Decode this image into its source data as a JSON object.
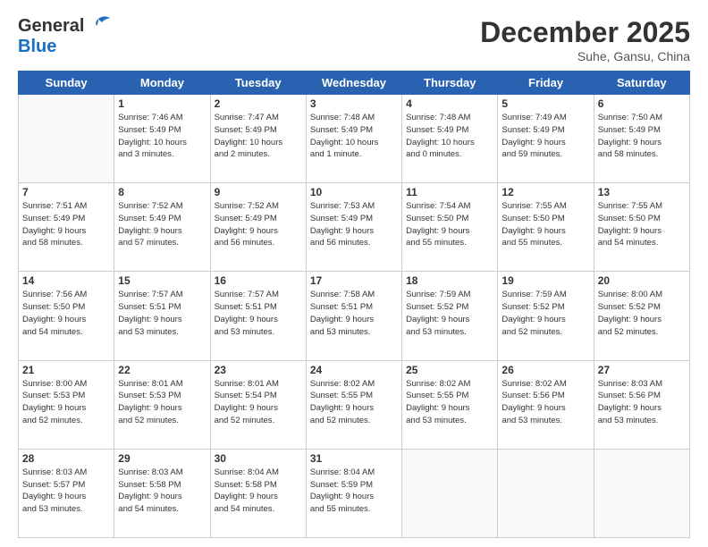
{
  "header": {
    "logo_general": "General",
    "logo_blue": "Blue",
    "month_title": "December 2025",
    "subtitle": "Suhe, Gansu, China"
  },
  "days_of_week": [
    "Sunday",
    "Monday",
    "Tuesday",
    "Wednesday",
    "Thursday",
    "Friday",
    "Saturday"
  ],
  "weeks": [
    [
      {
        "day": "",
        "info": ""
      },
      {
        "day": "1",
        "info": "Sunrise: 7:46 AM\nSunset: 5:49 PM\nDaylight: 10 hours\nand 3 minutes."
      },
      {
        "day": "2",
        "info": "Sunrise: 7:47 AM\nSunset: 5:49 PM\nDaylight: 10 hours\nand 2 minutes."
      },
      {
        "day": "3",
        "info": "Sunrise: 7:48 AM\nSunset: 5:49 PM\nDaylight: 10 hours\nand 1 minute."
      },
      {
        "day": "4",
        "info": "Sunrise: 7:48 AM\nSunset: 5:49 PM\nDaylight: 10 hours\nand 0 minutes."
      },
      {
        "day": "5",
        "info": "Sunrise: 7:49 AM\nSunset: 5:49 PM\nDaylight: 9 hours\nand 59 minutes."
      },
      {
        "day": "6",
        "info": "Sunrise: 7:50 AM\nSunset: 5:49 PM\nDaylight: 9 hours\nand 58 minutes."
      }
    ],
    [
      {
        "day": "7",
        "info": "Sunrise: 7:51 AM\nSunset: 5:49 PM\nDaylight: 9 hours\nand 58 minutes."
      },
      {
        "day": "8",
        "info": "Sunrise: 7:52 AM\nSunset: 5:49 PM\nDaylight: 9 hours\nand 57 minutes."
      },
      {
        "day": "9",
        "info": "Sunrise: 7:52 AM\nSunset: 5:49 PM\nDaylight: 9 hours\nand 56 minutes."
      },
      {
        "day": "10",
        "info": "Sunrise: 7:53 AM\nSunset: 5:49 PM\nDaylight: 9 hours\nand 56 minutes."
      },
      {
        "day": "11",
        "info": "Sunrise: 7:54 AM\nSunset: 5:50 PM\nDaylight: 9 hours\nand 55 minutes."
      },
      {
        "day": "12",
        "info": "Sunrise: 7:55 AM\nSunset: 5:50 PM\nDaylight: 9 hours\nand 55 minutes."
      },
      {
        "day": "13",
        "info": "Sunrise: 7:55 AM\nSunset: 5:50 PM\nDaylight: 9 hours\nand 54 minutes."
      }
    ],
    [
      {
        "day": "14",
        "info": "Sunrise: 7:56 AM\nSunset: 5:50 PM\nDaylight: 9 hours\nand 54 minutes."
      },
      {
        "day": "15",
        "info": "Sunrise: 7:57 AM\nSunset: 5:51 PM\nDaylight: 9 hours\nand 53 minutes."
      },
      {
        "day": "16",
        "info": "Sunrise: 7:57 AM\nSunset: 5:51 PM\nDaylight: 9 hours\nand 53 minutes."
      },
      {
        "day": "17",
        "info": "Sunrise: 7:58 AM\nSunset: 5:51 PM\nDaylight: 9 hours\nand 53 minutes."
      },
      {
        "day": "18",
        "info": "Sunrise: 7:59 AM\nSunset: 5:52 PM\nDaylight: 9 hours\nand 53 minutes."
      },
      {
        "day": "19",
        "info": "Sunrise: 7:59 AM\nSunset: 5:52 PM\nDaylight: 9 hours\nand 52 minutes."
      },
      {
        "day": "20",
        "info": "Sunrise: 8:00 AM\nSunset: 5:52 PM\nDaylight: 9 hours\nand 52 minutes."
      }
    ],
    [
      {
        "day": "21",
        "info": "Sunrise: 8:00 AM\nSunset: 5:53 PM\nDaylight: 9 hours\nand 52 minutes."
      },
      {
        "day": "22",
        "info": "Sunrise: 8:01 AM\nSunset: 5:53 PM\nDaylight: 9 hours\nand 52 minutes."
      },
      {
        "day": "23",
        "info": "Sunrise: 8:01 AM\nSunset: 5:54 PM\nDaylight: 9 hours\nand 52 minutes."
      },
      {
        "day": "24",
        "info": "Sunrise: 8:02 AM\nSunset: 5:55 PM\nDaylight: 9 hours\nand 52 minutes."
      },
      {
        "day": "25",
        "info": "Sunrise: 8:02 AM\nSunset: 5:55 PM\nDaylight: 9 hours\nand 53 minutes."
      },
      {
        "day": "26",
        "info": "Sunrise: 8:02 AM\nSunset: 5:56 PM\nDaylight: 9 hours\nand 53 minutes."
      },
      {
        "day": "27",
        "info": "Sunrise: 8:03 AM\nSunset: 5:56 PM\nDaylight: 9 hours\nand 53 minutes."
      }
    ],
    [
      {
        "day": "28",
        "info": "Sunrise: 8:03 AM\nSunset: 5:57 PM\nDaylight: 9 hours\nand 53 minutes."
      },
      {
        "day": "29",
        "info": "Sunrise: 8:03 AM\nSunset: 5:58 PM\nDaylight: 9 hours\nand 54 minutes."
      },
      {
        "day": "30",
        "info": "Sunrise: 8:04 AM\nSunset: 5:58 PM\nDaylight: 9 hours\nand 54 minutes."
      },
      {
        "day": "31",
        "info": "Sunrise: 8:04 AM\nSunset: 5:59 PM\nDaylight: 9 hours\nand 55 minutes."
      },
      {
        "day": "",
        "info": ""
      },
      {
        "day": "",
        "info": ""
      },
      {
        "day": "",
        "info": ""
      }
    ]
  ]
}
